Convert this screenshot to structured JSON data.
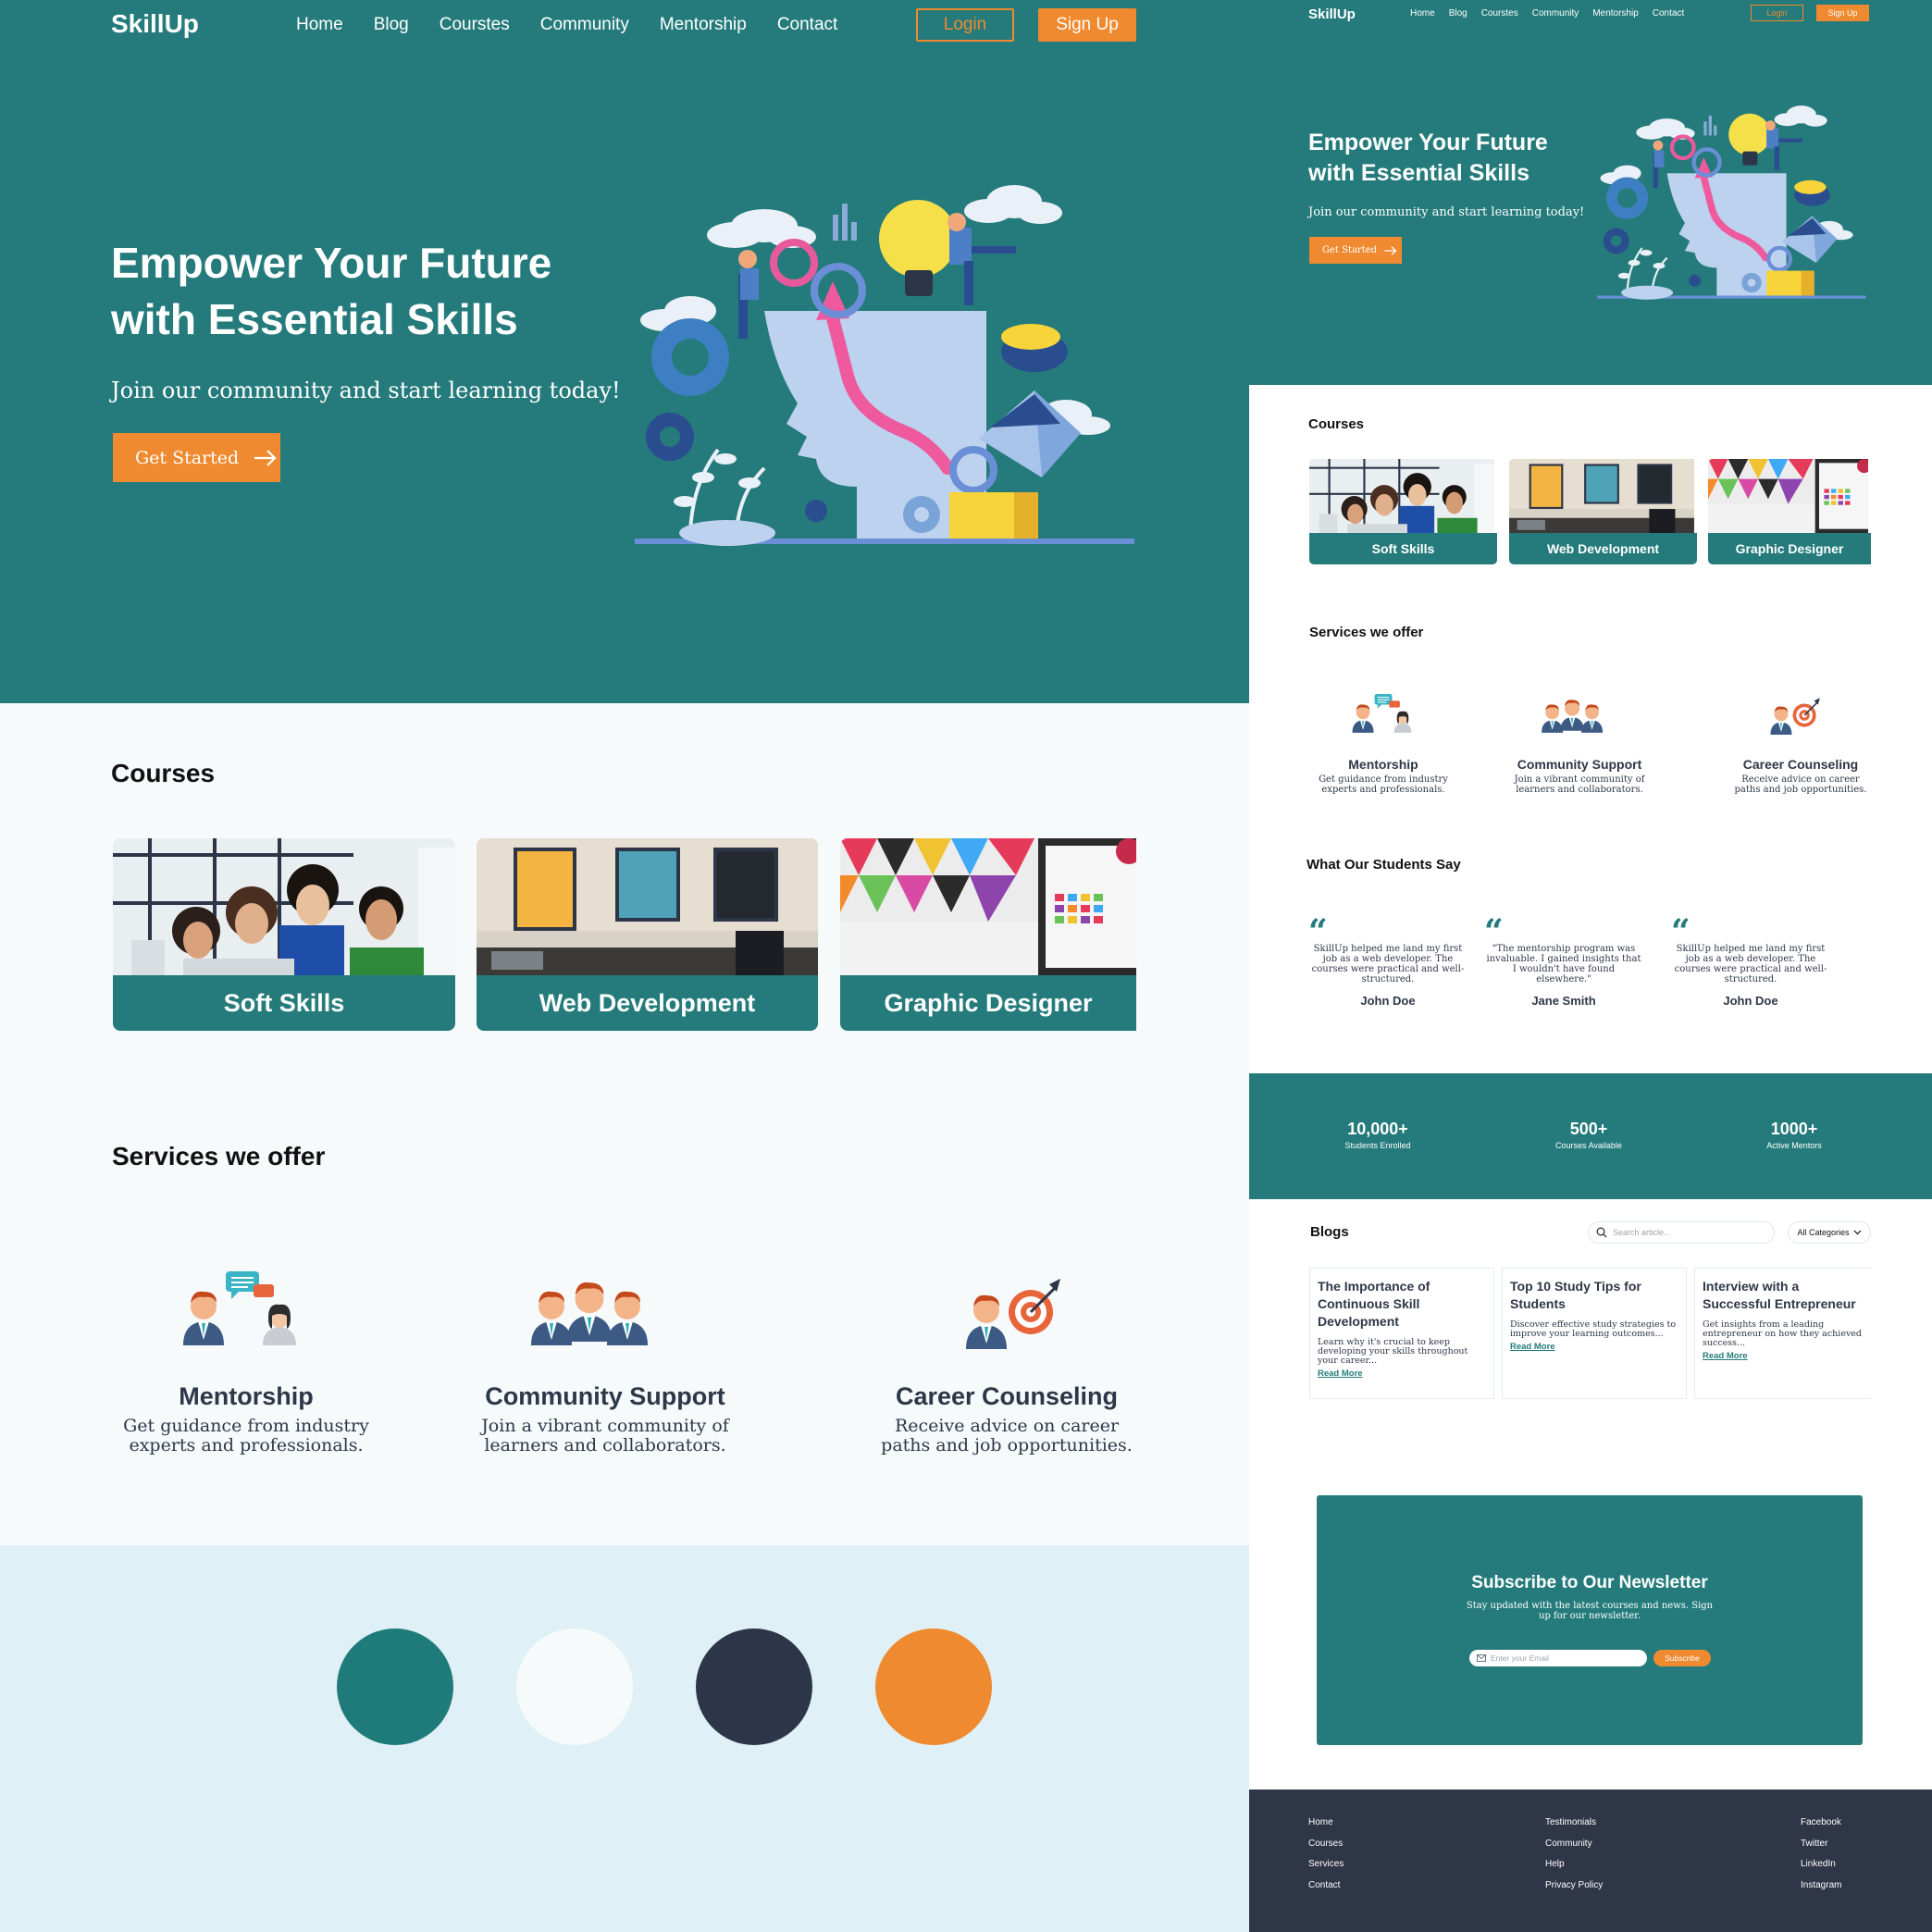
{
  "brand": "SkillUp",
  "nav": [
    "Home",
    "Blog",
    "Courstes",
    "Community",
    "Mentorship",
    "Contact"
  ],
  "auth": {
    "login": "Login",
    "signup": "Sign Up"
  },
  "hero": {
    "title": "Empower Your Future with Essential Skills",
    "subtitle": "Join our community and start learning today!",
    "cta": "Get Started"
  },
  "courses": {
    "title": "Courses",
    "items": [
      "Soft Skills",
      "Web Development",
      "Graphic Designer"
    ]
  },
  "services": {
    "title": "Services we offer",
    "items": [
      {
        "title": "Mentorship",
        "desc": "Get guidance from industry experts and professionals."
      },
      {
        "title": "Community Support",
        "desc": "Join a vibrant community of learners and collaborators."
      },
      {
        "title": "Career Counseling",
        "desc": "Receive advice on career paths and job opportunities."
      }
    ]
  },
  "palette": [
    "#1f7b79",
    "#f6fafb",
    "#2d3648",
    "#ef8a30"
  ],
  "testimonials": {
    "title": "What Our Students Say",
    "items": [
      {
        "quote": "SkillUp helped me land my first job as a web developer. The courses were practical and well-structured.",
        "name": "John Doe"
      },
      {
        "quote": "\"The mentorship program was invaluable. I gained insights that I wouldn't have found elsewhere.\"",
        "name": "Jane Smith"
      },
      {
        "quote": "SkillUp helped me land my first job as a web developer. The courses were practical and well-structured.",
        "name": "John Doe"
      }
    ]
  },
  "stats": [
    {
      "value": "10,000+",
      "label": "Students Enrolled"
    },
    {
      "value": "500+",
      "label": "Courses Available"
    },
    {
      "value": "1000+",
      "label": "Active Mentors"
    }
  ],
  "blogs": {
    "title": "Blogs",
    "search_placeholder": "Search article...",
    "category": "All Categories",
    "read_more": "Read More",
    "items": [
      {
        "title": "The Importance of Continuous Skill Development",
        "excerpt": "Learn why it's crucial to keep developing your skills throughout your career..."
      },
      {
        "title": "Top 10 Study Tips for Students",
        "excerpt": "Discover effective study strategies to improve your learning outcomes..."
      },
      {
        "title": "Interview with a Successful Entrepreneur",
        "excerpt": "Get insights from a leading entrepreneur on how they achieved success..."
      }
    ]
  },
  "newsletter": {
    "title": "Subscribe to Our Newsletter",
    "subtitle": "Stay updated with the latest courses and news. Sign up for our newsletter.",
    "placeholder": "Enter your Email",
    "button": "Subscribe"
  },
  "footer": {
    "col1": [
      "Home",
      "Courses",
      "Services",
      "Contact"
    ],
    "col2": [
      "Testimonials",
      "Community",
      "Help",
      "Privacy Policy"
    ],
    "col3": [
      "Facebook",
      "Twitter",
      "LinkedIn",
      "Instagram"
    ]
  }
}
